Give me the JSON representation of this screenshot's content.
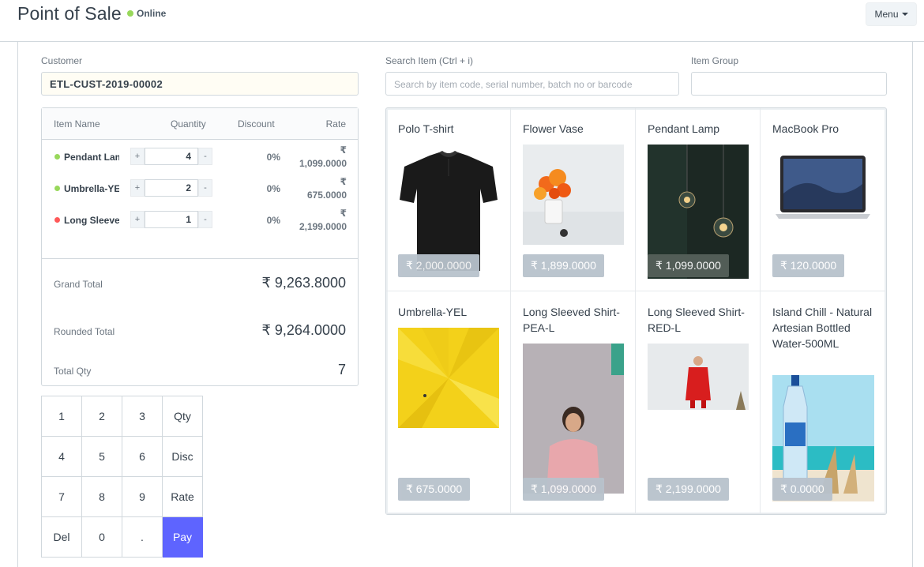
{
  "header": {
    "title": "Point of Sale",
    "status": "Online",
    "menu_label": "Menu"
  },
  "customer": {
    "label": "Customer",
    "value": "ETL-CUST-2019-00002"
  },
  "search": {
    "label": "Search Item (Ctrl + i)",
    "placeholder": "Search by item code, serial number, batch no or barcode",
    "group_label": "Item Group"
  },
  "cart": {
    "columns": [
      "Item Name",
      "Quantity",
      "Discount",
      "Rate"
    ],
    "currency": "₹",
    "items": [
      {
        "name": "Pendant Lamp",
        "qty": "4",
        "discount": "0%",
        "rate": "1,099.0000",
        "plus": "+",
        "minus": "-",
        "stock_color": "#98d85b"
      },
      {
        "name": "Umbrella-YEL",
        "qty": "2",
        "discount": "0%",
        "rate": "675.0000",
        "plus": "+",
        "minus": "-",
        "stock_color": "#98d85b"
      },
      {
        "name": "Long Sleeved Shirt-RED-L",
        "qty": "1",
        "discount": "0%",
        "rate": "2,199.0000",
        "plus": "+",
        "minus": "-",
        "stock_color": "#ff5858"
      }
    ],
    "grand_total_label": "Grand Total",
    "grand_total": "₹ 9,263.8000",
    "rounded_total_label": "Rounded Total",
    "rounded_total": "₹ 9,264.0000",
    "total_qty_label": "Total Qty",
    "total_qty": "7"
  },
  "numpad": {
    "keys": [
      "1",
      "2",
      "3",
      "Qty",
      "4",
      "5",
      "6",
      "Disc",
      "7",
      "8",
      "9",
      "Rate",
      "Del",
      "0",
      ".",
      "Pay"
    ]
  },
  "items": [
    {
      "name": "Polo T-shirt",
      "price": "₹ 2,000.0000",
      "icon": "polo-tshirt-image"
    },
    {
      "name": "Flower Vase",
      "price": "₹ 1,899.0000",
      "icon": "flower-vase-image"
    },
    {
      "name": "Pendant Lamp",
      "price": "₹ 1,099.0000",
      "icon": "pendant-lamp-image"
    },
    {
      "name": "MacBook Pro",
      "price": "₹ 120.0000",
      "icon": "macbook-image"
    },
    {
      "name": "Umbrella-YEL",
      "price": "₹ 675.0000",
      "icon": "umbrella-image"
    },
    {
      "name": "Long Sleeved Shirt-PEA-L",
      "price": "₹ 1,099.0000",
      "icon": "pink-shirt-image"
    },
    {
      "name": "Long Sleeved Shirt-RED-L",
      "price": "₹ 2,199.0000",
      "icon": "red-shirt-image"
    },
    {
      "name": "Island Chill - Natural Artesian Bottled Water-500ML",
      "price": "₹ 0.0000",
      "icon": "water-bottle-image"
    }
  ],
  "colors": {
    "accent": "#5e64ff",
    "online": "#98d85b",
    "border": "#d1d8dd"
  }
}
